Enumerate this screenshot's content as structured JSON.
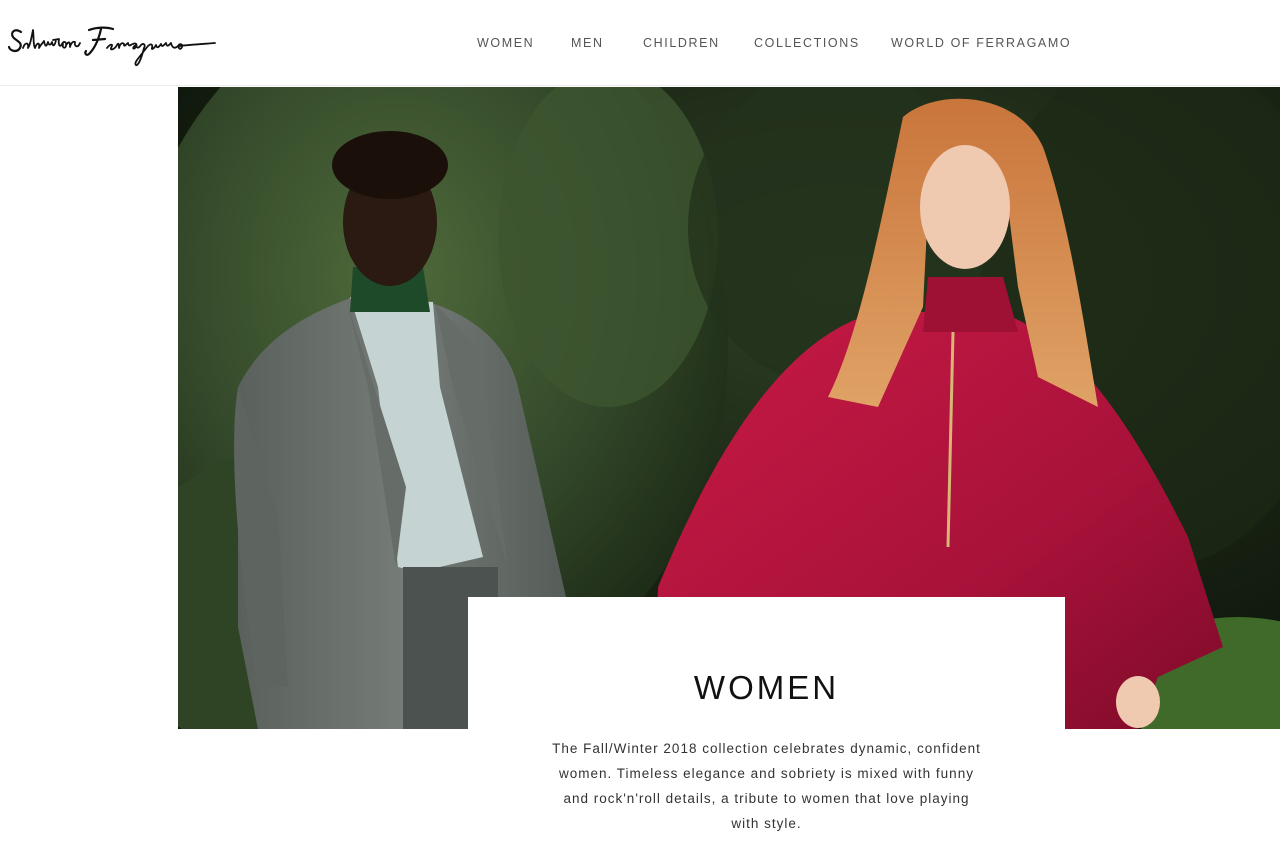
{
  "brand": {
    "logo_text": "Salvatore Ferragamo"
  },
  "nav": {
    "items": [
      {
        "label": "WOMEN"
      },
      {
        "label": "MEN"
      },
      {
        "label": "CHILDREN"
      },
      {
        "label": "COLLECTIONS"
      },
      {
        "label": "WORLD OF FERRAGAMO"
      }
    ]
  },
  "hero": {
    "image_alt": ""
  },
  "feature": {
    "title": "WOMEN",
    "description": "The Fall/Winter 2018 collection celebrates dynamic, confident women. Timeless elegance and sobriety is mixed with funny and rock'n'roll details, a tribute to women that love playing with style."
  },
  "colors": {
    "background": "#ffffff",
    "nav_text": "#555555",
    "title_text": "#111111",
    "body_text": "#333333",
    "foliage_dark": "#1d2a18",
    "cape_red": "#b3123a",
    "suit_grey": "#6b716d"
  }
}
